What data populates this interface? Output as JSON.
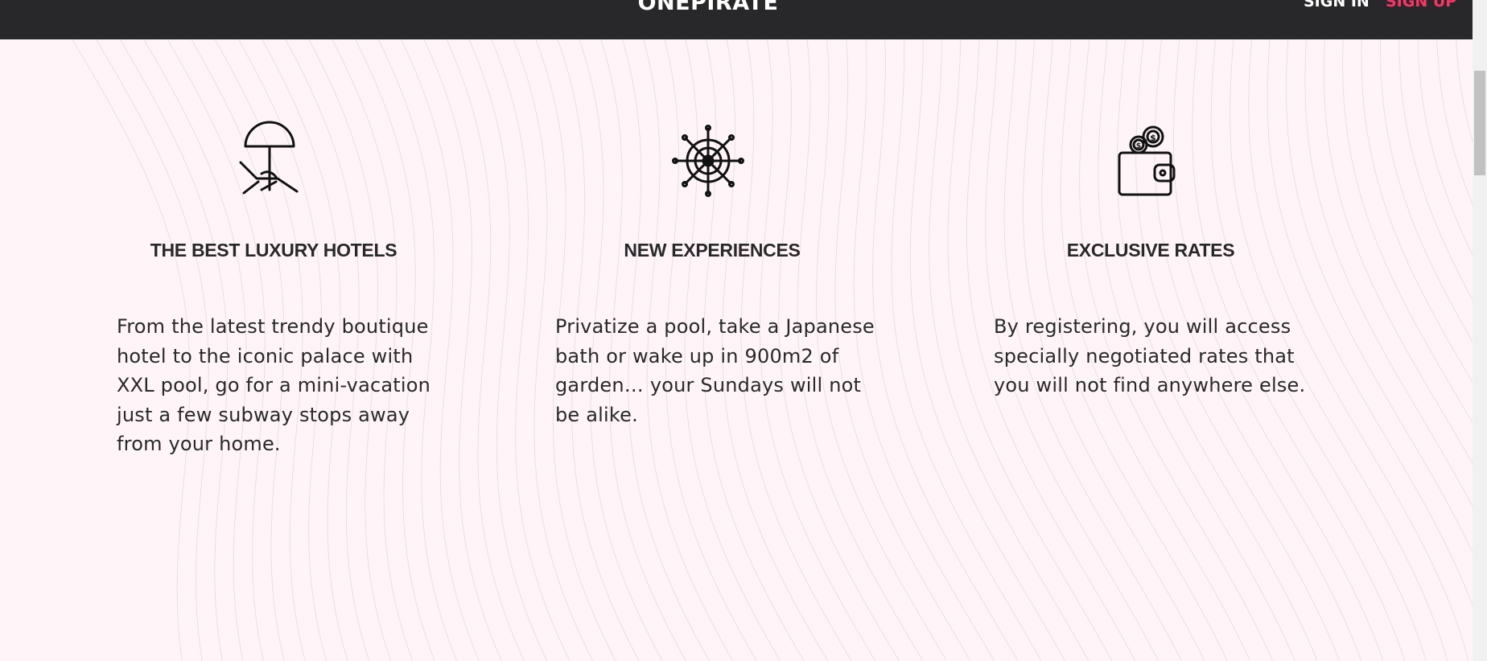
{
  "header": {
    "brand": "ONEPIRATE",
    "sign_in": "SIGN IN",
    "sign_up": "SIGN UP"
  },
  "colors": {
    "header_bg": "#28282a",
    "page_bg": "#fff5f8",
    "accent": "#ff3366",
    "text": "#28282a"
  },
  "features": [
    {
      "icon": "beach-umbrella-icon",
      "title": "THE BEST LUXURY HOTELS",
      "description": "From the latest trendy boutique hotel to the iconic palace with XXL pool, go for a mini-vacation just a few subway stops away from your home."
    },
    {
      "icon": "ship-wheel-icon",
      "title": "NEW EXPERIENCES",
      "description": "Privatize a pool, take a Japanese bath or wake up in 900m2 of garden… your Sundays will not be alike."
    },
    {
      "icon": "wallet-coins-icon",
      "title": "EXCLUSIVE RATES",
      "description": "By registering, you will access specially negotiated rates that you will not find anywhere else."
    }
  ]
}
